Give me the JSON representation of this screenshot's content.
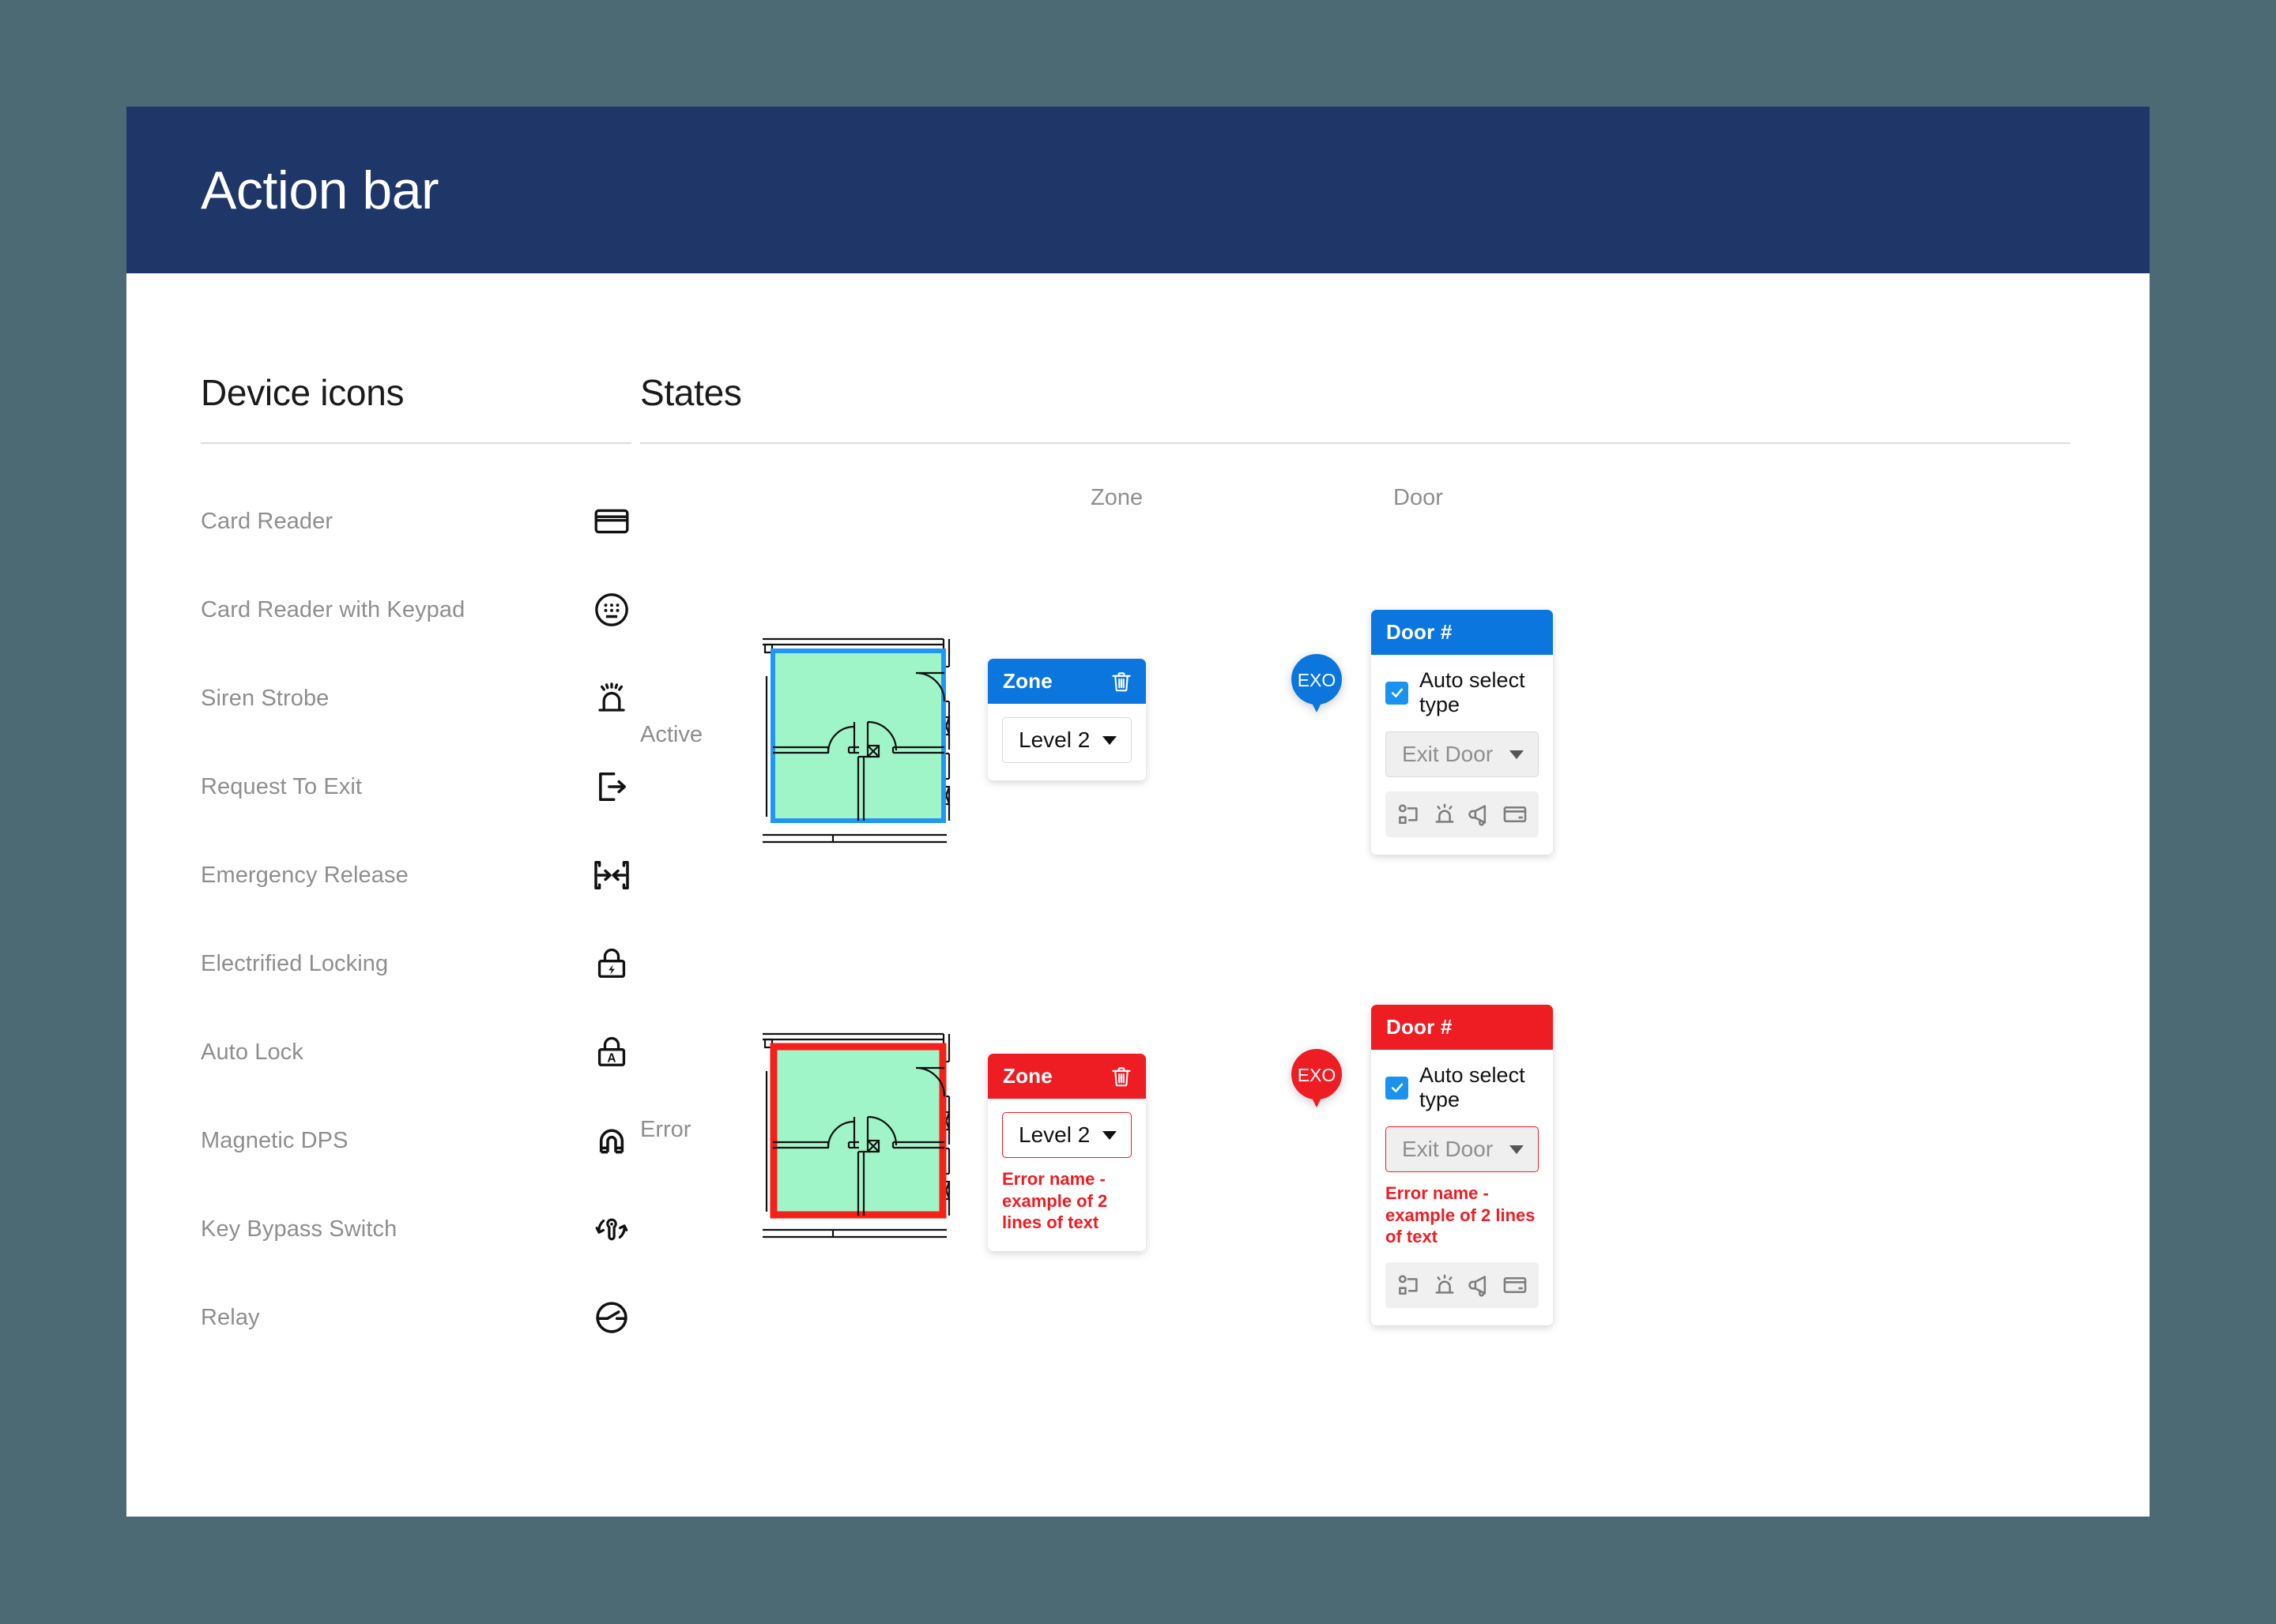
{
  "action_bar": {
    "title": "Action bar"
  },
  "colors": {
    "page_background": "#4C6A73",
    "action_bar": "#1F3668",
    "accent_blue": "#0B76DE",
    "error_red": "#EE1C23",
    "checkbox_blue": "#1A93F0",
    "zone_fill_green": "#A0F5C8",
    "muted_text": "#8E8E8E"
  },
  "devices": {
    "title": "Device icons",
    "items": [
      {
        "label": "Card Reader",
        "icon": "card-reader-icon"
      },
      {
        "label": "Card Reader with Keypad",
        "icon": "card-reader-keypad-icon"
      },
      {
        "label": "Siren Strobe",
        "icon": "siren-strobe-icon"
      },
      {
        "label": "Request To Exit",
        "icon": "request-to-exit-icon"
      },
      {
        "label": "Emergency Release",
        "icon": "emergency-release-icon"
      },
      {
        "label": "Electrified Locking",
        "icon": "electrified-locking-icon"
      },
      {
        "label": "Auto Lock",
        "icon": "auto-lock-icon"
      },
      {
        "label": "Magnetic DPS",
        "icon": "magnetic-dps-icon"
      },
      {
        "label": "Key Bypass Switch",
        "icon": "key-bypass-switch-icon"
      },
      {
        "label": "Relay",
        "icon": "relay-icon"
      }
    ]
  },
  "states": {
    "title": "States",
    "columns": {
      "zone": "Zone",
      "door": "Door"
    },
    "rows": [
      {
        "state_label": "Active",
        "zone_card": {
          "header_title": "Zone",
          "delete_icon": "trash-icon",
          "select_value": "Level 2",
          "error_text": ""
        },
        "door_card": {
          "header_title": "Door #",
          "checkbox_label": "Auto select type",
          "checkbox_checked": true,
          "select_value": "Exit Door",
          "select_disabled": true,
          "error_text": "",
          "strip_icons": [
            "door-contact-icon",
            "siren-strobe-icon",
            "horn-speaker-icon",
            "card-reader-icon"
          ]
        },
        "pin": {
          "label": "EXO",
          "color": "#0B76DE"
        }
      },
      {
        "state_label": "Error",
        "zone_card": {
          "header_title": "Zone",
          "delete_icon": "trash-icon",
          "select_value": "Level 2",
          "error_text": "Error name - example of 2 lines of text"
        },
        "door_card": {
          "header_title": "Door #",
          "checkbox_label": "Auto select type",
          "checkbox_checked": true,
          "select_value": "Exit Door",
          "select_disabled": true,
          "error_text": "Error name - example of 2 lines of text",
          "strip_icons": [
            "door-contact-icon",
            "siren-strobe-icon",
            "horn-speaker-icon",
            "card-reader-icon"
          ]
        },
        "pin": {
          "label": "EXO",
          "color": "#EE1C23"
        }
      }
    ]
  }
}
